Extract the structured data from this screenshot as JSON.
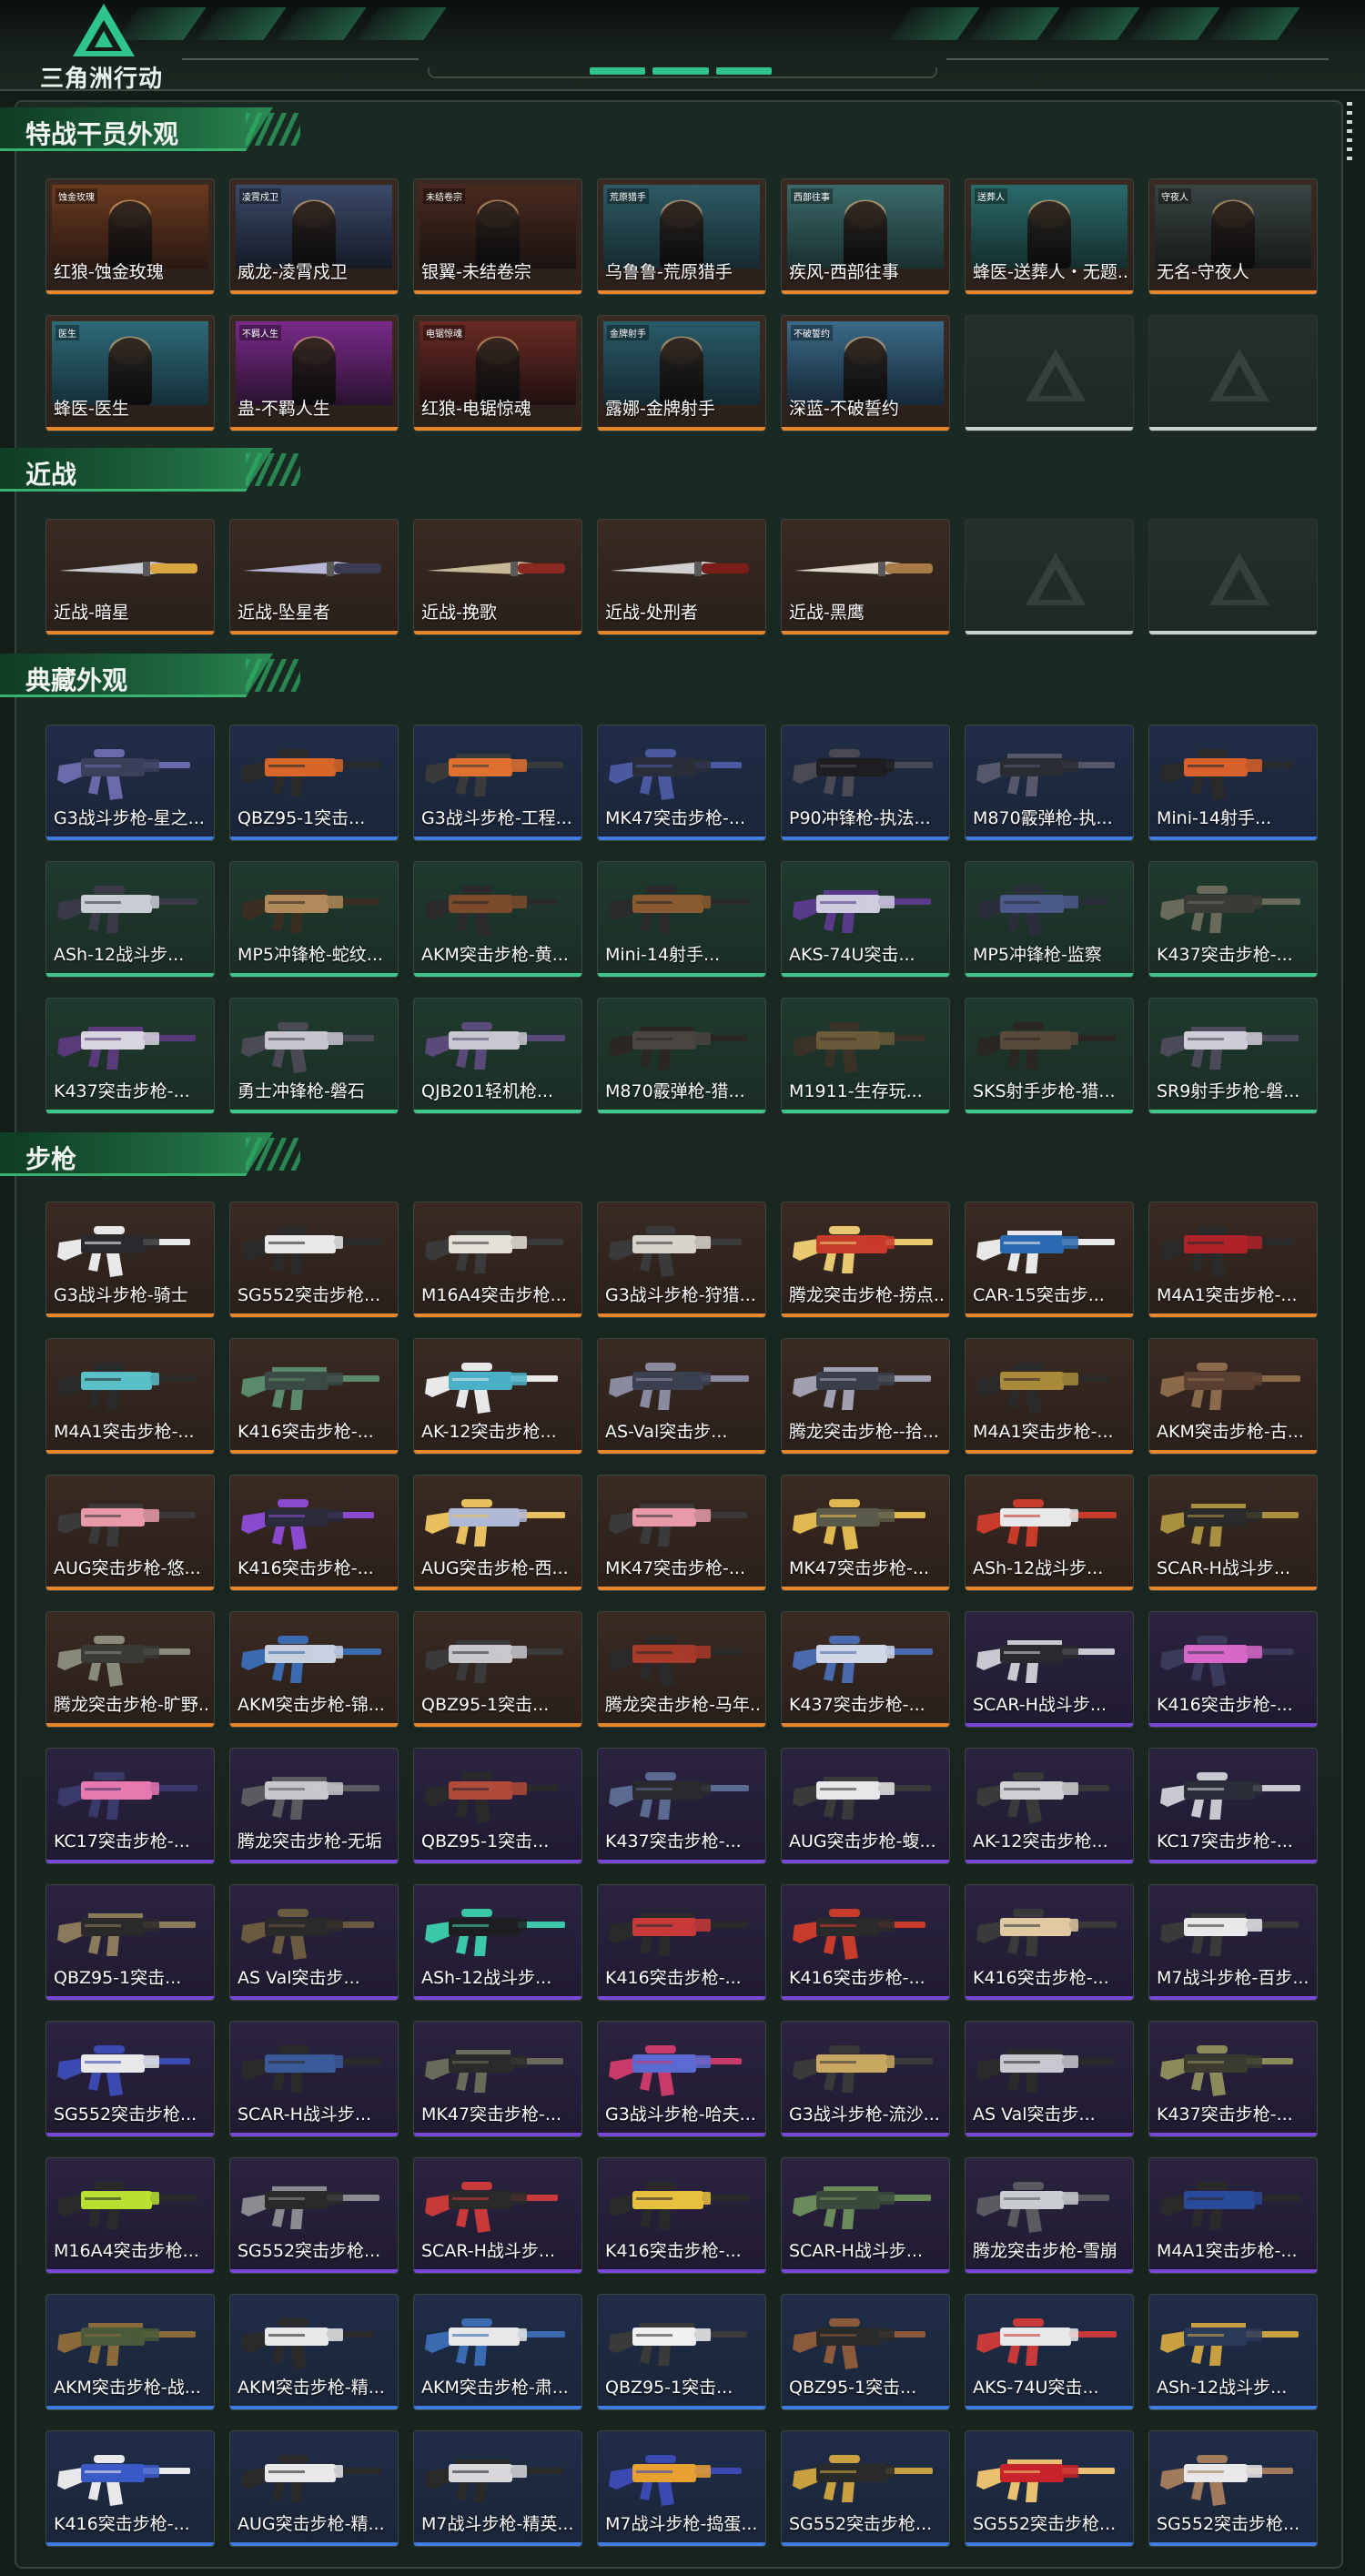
{
  "app": {
    "logo_text": "三角洲行动",
    "colors": {
      "accent": "#2fc48e",
      "orange": "#e8862c",
      "purple": "#7a48d8",
      "blue": "#3f7be0",
      "green": "#3fc68a",
      "white": "#c9d1cc"
    }
  },
  "sections": [
    {
      "title": "特战干员外观",
      "items": [
        {
          "name": "红狼-蚀金玫瑰",
          "rarity": "orange",
          "kind": "portrait",
          "tag": "蚀金玫瑰",
          "c1": "#6b3a1e",
          "c2": "#2a1810"
        },
        {
          "name": "威龙-凌霄戍卫",
          "rarity": "orange",
          "kind": "portrait",
          "tag": "凌霄戍卫",
          "c1": "#3b4a6a",
          "c2": "#151a26"
        },
        {
          "name": "银翼-未结卷宗",
          "rarity": "orange",
          "kind": "portrait",
          "tag": "未结卷宗",
          "c1": "#4a2a1e",
          "c2": "#1a1210"
        },
        {
          "name": "乌鲁鲁-荒原猎手",
          "rarity": "orange",
          "kind": "portrait",
          "tag": "荒原猎手",
          "c1": "#2d5a66",
          "c2": "#162a30"
        },
        {
          "name": "疾风-西部往事",
          "rarity": "orange",
          "kind": "portrait",
          "tag": "西部往事",
          "c1": "#3a6a6a",
          "c2": "#1a3030"
        },
        {
          "name": "蜂医-送葬人・无题...",
          "rarity": "orange",
          "kind": "portrait",
          "tag": "送葬人",
          "c1": "#2a6a6a",
          "c2": "#142e2e"
        },
        {
          "name": "无名-守夜人",
          "rarity": "orange",
          "kind": "portrait",
          "tag": "守夜人",
          "c1": "#3a4444",
          "c2": "#161a1a"
        },
        {
          "name": "蜂医-医生",
          "rarity": "orange",
          "kind": "portrait",
          "tag": "医生",
          "c1": "#2e6a78",
          "c2": "#14303a"
        },
        {
          "name": "蛊-不羁人生",
          "rarity": "orange",
          "kind": "portrait",
          "tag": "不羁人生",
          "c1": "#7a2a8a",
          "c2": "#2a1230"
        },
        {
          "name": "红狼-电锯惊魂",
          "rarity": "orange",
          "kind": "portrait",
          "tag": "电锯惊魂",
          "c1": "#6a2a22",
          "c2": "#201010"
        },
        {
          "name": "露娜-金牌射手",
          "rarity": "orange",
          "kind": "portrait",
          "tag": "金牌射手",
          "c1": "#2a5a6a",
          "c2": "#142a32"
        },
        {
          "name": "深蓝-不破誓约",
          "rarity": "orange",
          "kind": "portrait",
          "tag": "不破誓约",
          "c1": "#3a6a88",
          "c2": "#162838"
        },
        {
          "name": "",
          "rarity": "empty",
          "kind": "empty"
        },
        {
          "name": "",
          "rarity": "empty",
          "kind": "empty"
        }
      ]
    },
    {
      "title": "近战",
      "items": [
        {
          "name": "近战-暗星",
          "rarity": "orange",
          "kind": "knife",
          "blade": "#c9ccd2",
          "handle": "#d9a640"
        },
        {
          "name": "近战-坠星者",
          "rarity": "orange",
          "kind": "knife",
          "blade": "#b8b6d6",
          "handle": "#3a3a55"
        },
        {
          "name": "近战-挽歌",
          "rarity": "orange",
          "kind": "knife",
          "blade": "#c8b89a",
          "handle": "#8a2a22"
        },
        {
          "name": "近战-处刑者",
          "rarity": "orange",
          "kind": "knife",
          "blade": "#d0d0d0",
          "handle": "#7a1e1a"
        },
        {
          "name": "近战-黑鹰",
          "rarity": "orange",
          "kind": "knife",
          "blade": "#e0d8c8",
          "handle": "#a87a48"
        },
        {
          "name": "",
          "rarity": "empty",
          "kind": "empty"
        },
        {
          "name": "",
          "rarity": "empty",
          "kind": "empty"
        }
      ]
    },
    {
      "title": "典藏外观",
      "items": [
        {
          "name": "G3战斗步枪-星之...",
          "rarity": "blue",
          "kind": "gun",
          "c": "#3a3f5a",
          "a": "#6a6aaa"
        },
        {
          "name": "QBZ95-1突击...",
          "rarity": "blue",
          "kind": "gun",
          "c": "#d8662a",
          "a": "#2a2a2a"
        },
        {
          "name": "G3战斗步枪-工程...",
          "rarity": "blue",
          "kind": "gun",
          "c": "#e07030",
          "a": "#3a3a3a"
        },
        {
          "name": "MK47突击步枪-...",
          "rarity": "blue",
          "kind": "gun",
          "c": "#2a2e3a",
          "a": "#4a5aa0"
        },
        {
          "name": "P90冲锋枪-执法...",
          "rarity": "blue",
          "kind": "gun",
          "c": "#1e1e22",
          "a": "#4a4a55"
        },
        {
          "name": "M870霰弹枪-执...",
          "rarity": "blue",
          "kind": "gun",
          "c": "#2a2c34",
          "a": "#55586a"
        },
        {
          "name": "Mini-14射手...",
          "rarity": "blue",
          "kind": "gun",
          "c": "#d8602a",
          "a": "#2a2a2a"
        },
        {
          "name": "ASh-12战斗步...",
          "rarity": "green",
          "kind": "gun",
          "c": "#c8ccd4",
          "a": "#3a3a48"
        },
        {
          "name": "MP5冲锋枪-蛇纹...",
          "rarity": "green",
          "kind": "gun",
          "c": "#b08a5a",
          "a": "#3a2e22"
        },
        {
          "name": "AKM突击步枪-黄...",
          "rarity": "green",
          "kind": "gun",
          "c": "#7a4a2a",
          "a": "#2a2a2a"
        },
        {
          "name": "Mini-14射手...",
          "rarity": "green",
          "kind": "gun",
          "c": "#8a5a30",
          "a": "#2a2a2a"
        },
        {
          "name": "AKS-74U突击...",
          "rarity": "green",
          "kind": "gun",
          "c": "#d0cce0",
          "a": "#5a3a8a"
        },
        {
          "name": "MP5冲锋枪-监察",
          "rarity": "green",
          "kind": "gun",
          "c": "#4a5a8a",
          "a": "#2a2e3a"
        },
        {
          "name": "K437突击步枪-...",
          "rarity": "green",
          "kind": "gun",
          "c": "#3a3a36",
          "a": "#6a6a5a"
        },
        {
          "name": "K437突击步枪-...",
          "rarity": "green",
          "kind": "gun",
          "c": "#d8d4e0",
          "a": "#5a3a7a"
        },
        {
          "name": "勇士冲锋枪-磐石",
          "rarity": "green",
          "kind": "gun",
          "c": "#c8c4d0",
          "a": "#4a4a55"
        },
        {
          "name": "QJB201轻机枪...",
          "rarity": "green",
          "kind": "gun",
          "c": "#c8c8d0",
          "a": "#5a4a7a"
        },
        {
          "name": "M870霰弹枪-猎...",
          "rarity": "green",
          "kind": "gun",
          "c": "#4a4540",
          "a": "#2a2622"
        },
        {
          "name": "M1911-生存玩...",
          "rarity": "green",
          "kind": "gun",
          "c": "#6a5a3a",
          "a": "#3a3226"
        },
        {
          "name": "SKS射手步枪-猎...",
          "rarity": "green",
          "kind": "gun",
          "c": "#5a4a3a",
          "a": "#2a2622"
        },
        {
          "name": "SR9射手步枪-磐...",
          "rarity": "green",
          "kind": "gun",
          "c": "#d0ccd8",
          "a": "#4a4a5a"
        }
      ]
    },
    {
      "title": "步枪",
      "items": [
        {
          "name": "G3战斗步枪-骑士",
          "rarity": "orange",
          "kind": "gun",
          "c": "#2a2a2e",
          "a": "#e8e8e8"
        },
        {
          "name": "SG552突击步枪...",
          "rarity": "orange",
          "kind": "gun",
          "c": "#e8e8ea",
          "a": "#2a2a2a"
        },
        {
          "name": "M16A4突击步枪...",
          "rarity": "orange",
          "kind": "gun",
          "c": "#e4e0d8",
          "a": "#3a3a3a"
        },
        {
          "name": "G3战斗步枪-狩猎...",
          "rarity": "orange",
          "kind": "gun",
          "c": "#d8d4cc",
          "a": "#3a3a3a"
        },
        {
          "name": "腾龙突击步枪-捞点...",
          "rarity": "orange",
          "kind": "gun",
          "c": "#c83a2a",
          "a": "#e8c870"
        },
        {
          "name": "CAR-15突击步...",
          "rarity": "orange",
          "kind": "gun",
          "c": "#2a6ab0",
          "a": "#e8e8e8"
        },
        {
          "name": "M4A1突击步枪-...",
          "rarity": "orange",
          "kind": "gun",
          "c": "#b0222a",
          "a": "#2a2a2a"
        },
        {
          "name": "M4A1突击步枪-...",
          "rarity": "orange",
          "kind": "gun",
          "c": "#5ac0c8",
          "a": "#2a2a2a"
        },
        {
          "name": "K416突击步枪-...",
          "rarity": "orange",
          "kind": "gun",
          "c": "#3a4a44",
          "a": "#5a8a6a"
        },
        {
          "name": "AK-12突击步枪...",
          "rarity": "orange",
          "kind": "gun",
          "c": "#4ab0c8",
          "a": "#e8e8e8"
        },
        {
          "name": "AS-Val突击步...",
          "rarity": "orange",
          "kind": "gun",
          "c": "#3a4050",
          "a": "#8a8aa0"
        },
        {
          "name": "腾龙突击步枪--拾...",
          "rarity": "orange",
          "kind": "gun",
          "c": "#3a3e4a",
          "a": "#a0a0b0"
        },
        {
          "name": "M4A1突击步枪-...",
          "rarity": "orange",
          "kind": "gun",
          "c": "#a88a3a",
          "a": "#2a2a2a"
        },
        {
          "name": "AKM突击步枪-古...",
          "rarity": "orange",
          "kind": "gun",
          "c": "#5a4030",
          "a": "#8a6a4a"
        },
        {
          "name": "AUG突击步枪-悠...",
          "rarity": "orange",
          "kind": "gun",
          "c": "#e89aa8",
          "a": "#3a3a3a"
        },
        {
          "name": "K416突击步枪-...",
          "rarity": "orange",
          "kind": "gun",
          "c": "#2a2a3a",
          "a": "#8a4ad0"
        },
        {
          "name": "AUG突击步枪-西...",
          "rarity": "orange",
          "kind": "gun",
          "c": "#b0b8d8",
          "a": "#e8c060"
        },
        {
          "name": "MK47突击步枪-...",
          "rarity": "orange",
          "kind": "gun",
          "c": "#e89aa8",
          "a": "#3a3a3a"
        },
        {
          "name": "MK47突击步枪-...",
          "rarity": "orange",
          "kind": "gun",
          "c": "#5a5a4a",
          "a": "#e0b850"
        },
        {
          "name": "ASh-12战斗步...",
          "rarity": "orange",
          "kind": "gun",
          "c": "#e8e8ea",
          "a": "#c83a2a"
        },
        {
          "name": "SCAR-H战斗步...",
          "rarity": "orange",
          "kind": "gun",
          "c": "#2a2a2a",
          "a": "#a89040"
        },
        {
          "name": "腾龙突击步枪-旷野...",
          "rarity": "orange",
          "kind": "gun",
          "c": "#3a3a36",
          "a": "#8a8a7a"
        },
        {
          "name": "AKM突击步枪-锦...",
          "rarity": "orange",
          "kind": "gun",
          "c": "#c8d0e0",
          "a": "#3a6ab0"
        },
        {
          "name": "QBZ95-1突击...",
          "rarity": "orange",
          "kind": "gun",
          "c": "#c8c8cc",
          "a": "#3a3a3a"
        },
        {
          "name": "腾龙突击步枪-马年...",
          "rarity": "orange",
          "kind": "gun",
          "c": "#a83a2a",
          "a": "#2a2a2a"
        },
        {
          "name": "K437突击步枪-...",
          "rarity": "orange",
          "kind": "gun",
          "c": "#d0d8e8",
          "a": "#4a6ab0"
        },
        {
          "name": "SCAR-H战斗步...",
          "rarity": "purple",
          "kind": "gun",
          "c": "#2a2a2e",
          "a": "#c8c8d0"
        },
        {
          "name": "K416突击步枪-...",
          "rarity": "purple",
          "kind": "gun",
          "c": "#d868c8",
          "a": "#3a3a5a"
        },
        {
          "name": "KC17突击步枪-...",
          "rarity": "purple",
          "kind": "gun",
          "c": "#e878b0",
          "a": "#3a3a6a"
        },
        {
          "name": "腾龙突击步枪-无垢",
          "rarity": "purple",
          "kind": "gun",
          "c": "#c8c8cc",
          "a": "#5a5a60"
        },
        {
          "name": "QBZ95-1突击...",
          "rarity": "purple",
          "kind": "gun",
          "c": "#b04a3a",
          "a": "#2a2a2a"
        },
        {
          "name": "K437突击步枪-...",
          "rarity": "purple",
          "kind": "gun",
          "c": "#2a2a2e",
          "a": "#5a6a90"
        },
        {
          "name": "AUG突击步枪-蝮...",
          "rarity": "purple",
          "kind": "gun",
          "c": "#e8e8ea",
          "a": "#3a3a3a"
        },
        {
          "name": "AK-12突击步枪...",
          "rarity": "purple",
          "kind": "gun",
          "c": "#d0d0d4",
          "a": "#3a3a3a"
        },
        {
          "name": "KC17突击步枪-...",
          "rarity": "purple",
          "kind": "gun",
          "c": "#2a2e3a",
          "a": "#c8c8d0"
        },
        {
          "name": "QBZ95-1突击...",
          "rarity": "purple",
          "kind": "gun",
          "c": "#2a2a2a",
          "a": "#8a7a5a"
        },
        {
          "name": "AS Val突击步...",
          "rarity": "purple",
          "kind": "gun",
          "c": "#2a2a2a",
          "a": "#6a5a40"
        },
        {
          "name": "ASh-12战斗步...",
          "rarity": "purple",
          "kind": "gun",
          "c": "#1e1e22",
          "a": "#3ac8a8"
        },
        {
          "name": "K416突击步枪-...",
          "rarity": "purple",
          "kind": "gun",
          "c": "#c83a3a",
          "a": "#2a2a2a"
        },
        {
          "name": "K416突击步枪-...",
          "rarity": "purple",
          "kind": "gun",
          "c": "#2a2a2a",
          "a": "#c83a2a"
        },
        {
          "name": "K416突击步枪-...",
          "rarity": "purple",
          "kind": "gun",
          "c": "#e0c8a0",
          "a": "#3a3a3a"
        },
        {
          "name": "M7战斗步枪-百步...",
          "rarity": "purple",
          "kind": "gun",
          "c": "#e8e8ea",
          "a": "#3a3a3a"
        },
        {
          "name": "SG552突击步枪...",
          "rarity": "purple",
          "kind": "gun",
          "c": "#e8e8ea",
          "a": "#3a4ab0"
        },
        {
          "name": "SCAR-H战斗步...",
          "rarity": "purple",
          "kind": "gun",
          "c": "#3a5a9a",
          "a": "#2a2a2a"
        },
        {
          "name": "MK47突击步枪-...",
          "rarity": "purple",
          "kind": "gun",
          "c": "#2a2a2a",
          "a": "#6a6a5a"
        },
        {
          "name": "G3战斗步枪-哈夫...",
          "rarity": "purple",
          "kind": "gun",
          "c": "#5a6ad0",
          "a": "#c83a6a"
        },
        {
          "name": "G3战斗步枪-流沙...",
          "rarity": "purple",
          "kind": "gun",
          "c": "#c8a860",
          "a": "#3a3a3a"
        },
        {
          "name": "AS Val突击步...",
          "rarity": "purple",
          "kind": "gun",
          "c": "#c8c8d0",
          "a": "#2a2a2a"
        },
        {
          "name": "K437突击步枪-...",
          "rarity": "purple",
          "kind": "gun",
          "c": "#3a3a2e",
          "a": "#8a8a5a"
        },
        {
          "name": "M16A4突击步枪...",
          "rarity": "purple",
          "kind": "gun",
          "c": "#b8e030",
          "a": "#2a2a2a"
        },
        {
          "name": "SG552突击步枪...",
          "rarity": "purple",
          "kind": "gun",
          "c": "#2a2a2a",
          "a": "#8a8a90"
        },
        {
          "name": "SCAR-H战斗步...",
          "rarity": "purple",
          "kind": "gun",
          "c": "#2a2a2a",
          "a": "#c83a3a"
        },
        {
          "name": "K416突击步枪-...",
          "rarity": "purple",
          "kind": "gun",
          "c": "#e8c040",
          "a": "#2a2a2a"
        },
        {
          "name": "SCAR-H战斗步...",
          "rarity": "purple",
          "kind": "gun",
          "c": "#3a4a3a",
          "a": "#6a8a5a"
        },
        {
          "name": "腾龙突击步枪-雪崩",
          "rarity": "purple",
          "kind": "gun",
          "c": "#c8ccd0",
          "a": "#5a5a60"
        },
        {
          "name": "M4A1突击步枪-...",
          "rarity": "purple",
          "kind": "gun",
          "c": "#2a4a9a",
          "a": "#2a2a2a"
        },
        {
          "name": "AKM突击步枪-战...",
          "rarity": "blue",
          "kind": "gun",
          "c": "#4a5a3a",
          "a": "#8a6a3a"
        },
        {
          "name": "AKM突击步枪-精...",
          "rarity": "blue",
          "kind": "gun",
          "c": "#e8e8ea",
          "a": "#2a2a2a"
        },
        {
          "name": "AKM突击步枪-肃...",
          "rarity": "blue",
          "kind": "gun",
          "c": "#e8e8ea",
          "a": "#3a6ab0"
        },
        {
          "name": "QBZ95-1突击...",
          "rarity": "blue",
          "kind": "gun",
          "c": "#f0f0f2",
          "a": "#3a3a3a"
        },
        {
          "name": "QBZ95-1突击...",
          "rarity": "blue",
          "kind": "gun",
          "c": "#2a2a2a",
          "a": "#8a5a3a"
        },
        {
          "name": "AKS-74U突击...",
          "rarity": "blue",
          "kind": "gun",
          "c": "#e8e8ea",
          "a": "#c83a3a"
        },
        {
          "name": "ASh-12战斗步...",
          "rarity": "blue",
          "kind": "gun",
          "c": "#2a3a5a",
          "a": "#c8a040"
        },
        {
          "name": "K416突击步枪-...",
          "rarity": "blue",
          "kind": "gun",
          "c": "#3a5ac8",
          "a": "#e8e8ea"
        },
        {
          "name": "AUG突击步枪-精...",
          "rarity": "blue",
          "kind": "gun",
          "c": "#e8e8ea",
          "a": "#2a2a2a"
        },
        {
          "name": "M7战斗步枪-精英...",
          "rarity": "blue",
          "kind": "gun",
          "c": "#d8d8dc",
          "a": "#2a2a2a"
        },
        {
          "name": "M7战斗步枪-捣蛋...",
          "rarity": "blue",
          "kind": "gun",
          "c": "#e8a030",
          "a": "#3a4ab0"
        },
        {
          "name": "SG552突击步枪...",
          "rarity": "blue",
          "kind": "gun",
          "c": "#2a2a2a",
          "a": "#c8a040"
        },
        {
          "name": "SG552突击步枪...",
          "rarity": "blue",
          "kind": "gun",
          "c": "#c8222a",
          "a": "#e8c070"
        },
        {
          "name": "SG552突击步枪...",
          "rarity": "blue",
          "kind": "gun",
          "c": "#e8e8ea",
          "a": "#a07a5a"
        }
      ]
    }
  ]
}
